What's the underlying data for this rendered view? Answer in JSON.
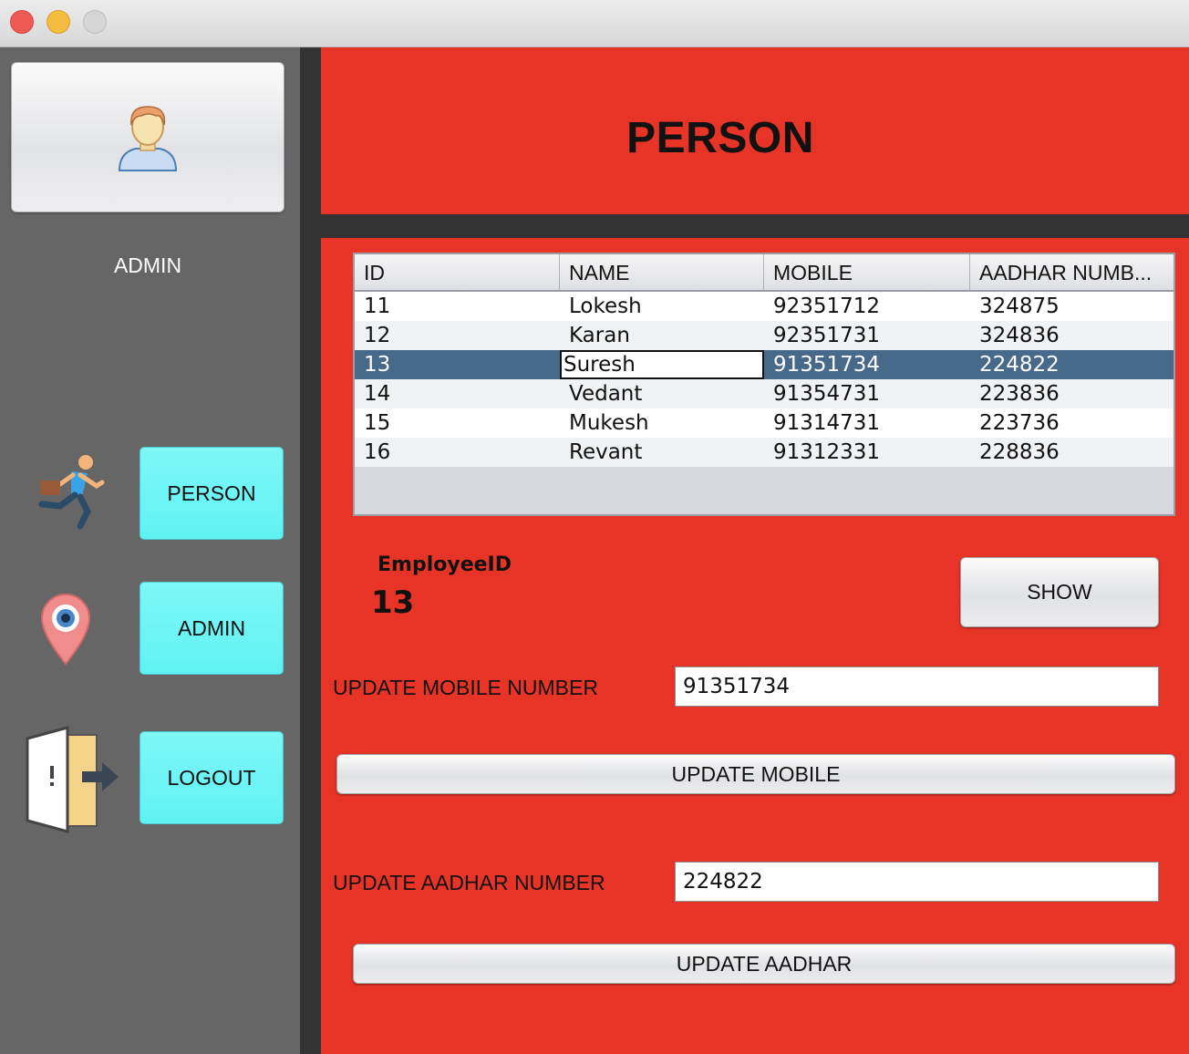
{
  "window": {
    "controls": [
      "close",
      "minimize",
      "maximize"
    ]
  },
  "sidebar": {
    "user_label": "ADMIN",
    "nav": [
      {
        "label": "PERSON",
        "icon": "running-man-icon"
      },
      {
        "label": "ADMIN",
        "icon": "location-pin-icon"
      },
      {
        "label": "LOGOUT",
        "icon": "exit-door-icon"
      }
    ],
    "avatar_icon": "user-avatar-icon"
  },
  "header": {
    "title": "PERSON"
  },
  "table": {
    "columns": [
      "ID",
      "NAME",
      "MOBILE",
      "AADHAR NUMB..."
    ],
    "rows": [
      [
        "11",
        "Lokesh",
        "92351712",
        "324875"
      ],
      [
        "12",
        "Karan",
        "92351731",
        "324836"
      ],
      [
        "13",
        "Suresh",
        "91351734",
        "224822"
      ],
      [
        "14",
        "Vedant",
        "91354731",
        "223836"
      ],
      [
        "15",
        "Mukesh",
        "91314731",
        "223736"
      ],
      [
        "16",
        "Revant",
        "91312331",
        "228836"
      ]
    ],
    "selected_row": 2
  },
  "employee": {
    "label": "EmployeeID",
    "value": "13"
  },
  "buttons": {
    "show": "SHOW",
    "update_mobile": "UPDATE MOBILE",
    "update_aadhar": "UPDATE AADHAR"
  },
  "fields": {
    "mobile_label": "UPDATE MOBILE NUMBER",
    "mobile_value": "91351734",
    "aadhar_label": "UPDATE AADHAR NUMBER",
    "aadhar_value": "224822"
  },
  "colors": {
    "sidebar": "#666666",
    "accent_red": "#e73426",
    "nav_button": "#6ff5f6",
    "selection": "#47698a",
    "divider": "#333333"
  }
}
